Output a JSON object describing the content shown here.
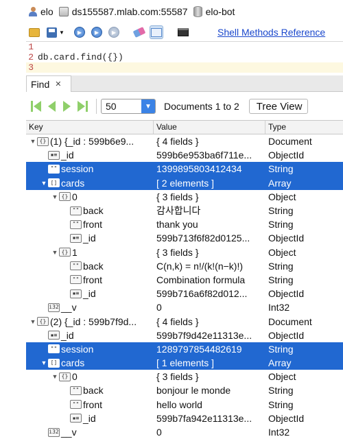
{
  "breadcrumb": {
    "user": "elo",
    "server": "ds155587.mlab.com:55587",
    "database": "elo-bot"
  },
  "toolbar": {
    "shell_methods_link": "Shell Methods Reference"
  },
  "editor": {
    "lines": [
      {
        "number": "1",
        "text": ""
      },
      {
        "number": "2",
        "text": "db.card.find({})"
      },
      {
        "number": "3",
        "text": ""
      }
    ]
  },
  "results": {
    "tab_label": "Find",
    "page_size": "50",
    "documents_label": "Documents 1 to 2",
    "view_mode": "Tree View",
    "columns": [
      "Key",
      "Value",
      "Type"
    ],
    "rows": [
      {
        "depth": 0,
        "toggle": "▼",
        "icon": "{}",
        "key": "(1) {_id : 599b6e9...",
        "value": "{ 4 fields }",
        "type": "Document",
        "selected": false
      },
      {
        "depth": 1,
        "toggle": "",
        "icon": "▪≡",
        "key": "_id",
        "value": "599b6e953ba6f711e...",
        "type": "ObjectId",
        "selected": false
      },
      {
        "depth": 1,
        "toggle": "",
        "icon": "\"\"",
        "key": "session",
        "value": "1399895803412434",
        "type": "String",
        "selected": true
      },
      {
        "depth": 1,
        "toggle": "▼",
        "icon": "[]",
        "key": "cards",
        "value": "[ 2 elements ]",
        "type": "Array",
        "selected": true
      },
      {
        "depth": 2,
        "toggle": "▼",
        "icon": "{}",
        "key": "0",
        "value": "{ 3 fields }",
        "type": "Object",
        "selected": false
      },
      {
        "depth": 3,
        "toggle": "",
        "icon": "\"\"",
        "key": "back",
        "value": "감사합니다",
        "type": "String",
        "selected": false
      },
      {
        "depth": 3,
        "toggle": "",
        "icon": "\"\"",
        "key": "front",
        "value": "thank you",
        "type": "String",
        "selected": false
      },
      {
        "depth": 3,
        "toggle": "",
        "icon": "▪≡",
        "key": "_id",
        "value": "599b713f6f82d0125...",
        "type": "ObjectId",
        "selected": false
      },
      {
        "depth": 2,
        "toggle": "▼",
        "icon": "{}",
        "key": "1",
        "value": "{ 3 fields }",
        "type": "Object",
        "selected": false
      },
      {
        "depth": 3,
        "toggle": "",
        "icon": "\"\"",
        "key": "back",
        "value": "C(n,k) = n!/(k!(n−k)!)",
        "type": "String",
        "selected": false
      },
      {
        "depth": 3,
        "toggle": "",
        "icon": "\"\"",
        "key": "front",
        "value": "Combination formula",
        "type": "String",
        "selected": false
      },
      {
        "depth": 3,
        "toggle": "",
        "icon": "▪≡",
        "key": "_id",
        "value": "599b716a6f82d012...",
        "type": "ObjectId",
        "selected": false
      },
      {
        "depth": 1,
        "toggle": "",
        "icon": "i32",
        "key": "__v",
        "value": "0",
        "type": "Int32",
        "selected": false
      },
      {
        "depth": 0,
        "toggle": "▼",
        "icon": "{}",
        "key": "(2) {_id : 599b7f9d...",
        "value": "{ 4 fields }",
        "type": "Document",
        "selected": false
      },
      {
        "depth": 1,
        "toggle": "",
        "icon": "▪≡",
        "key": "_id",
        "value": "599b7f9d42e11313e...",
        "type": "ObjectId",
        "selected": false
      },
      {
        "depth": 1,
        "toggle": "",
        "icon": "\"\"",
        "key": "session",
        "value": "1289797854482619",
        "type": "String",
        "selected": true
      },
      {
        "depth": 1,
        "toggle": "▼",
        "icon": "[]",
        "key": "cards",
        "value": "[ 1 elements ]",
        "type": "Array",
        "selected": true
      },
      {
        "depth": 2,
        "toggle": "▼",
        "icon": "{}",
        "key": "0",
        "value": "{ 3 fields }",
        "type": "Object",
        "selected": false
      },
      {
        "depth": 3,
        "toggle": "",
        "icon": "\"\"",
        "key": "back",
        "value": "bonjour le monde",
        "type": "String",
        "selected": false
      },
      {
        "depth": 3,
        "toggle": "",
        "icon": "\"\"",
        "key": "front",
        "value": "hello world",
        "type": "String",
        "selected": false
      },
      {
        "depth": 3,
        "toggle": "",
        "icon": "▪≡",
        "key": "_id",
        "value": "599b7fa942e11313e...",
        "type": "ObjectId",
        "selected": false
      },
      {
        "depth": 1,
        "toggle": "",
        "icon": "i32",
        "key": "__v",
        "value": "0",
        "type": "Int32",
        "selected": false
      }
    ]
  },
  "colors": {
    "selection": "#2168d1",
    "link": "#1a47cc",
    "nav_green": "#8fcf6a"
  }
}
